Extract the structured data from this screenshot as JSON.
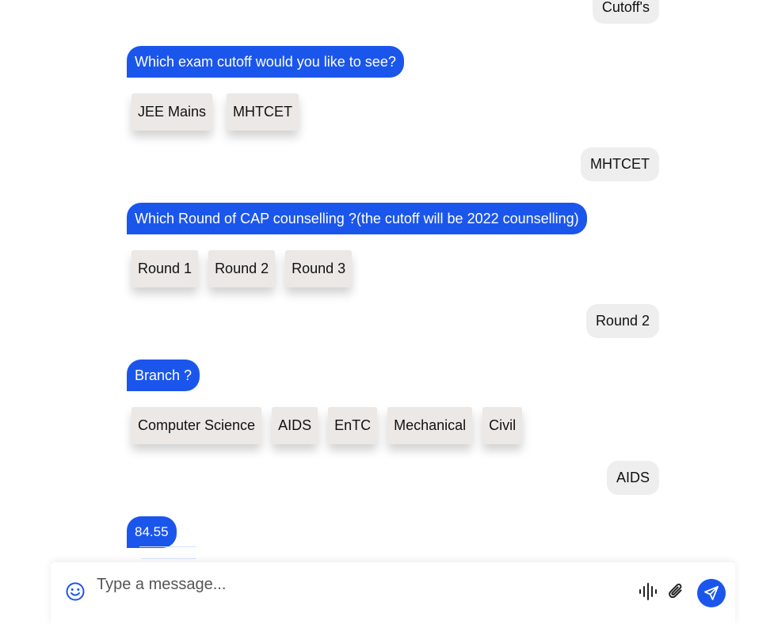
{
  "conversation": [
    {
      "from": "user",
      "text": "Cutoff's"
    },
    {
      "from": "bot",
      "text": "Which exam cutoff would you like to see?",
      "options": [
        "JEE Mains",
        "MHTCET"
      ]
    },
    {
      "from": "user",
      "text": "MHTCET"
    },
    {
      "from": "bot",
      "text": "Which Round of CAP counselling ?(the cutoff will be 2022 counselling)",
      "options": [
        "Round 1",
        "Round 2",
        "Round 3"
      ]
    },
    {
      "from": "user",
      "text": "Round 2"
    },
    {
      "from": "bot",
      "text": "Branch ?",
      "options": [
        "Computer Science",
        "AIDS",
        "EnTC",
        "Mechanical",
        "Civil"
      ]
    },
    {
      "from": "user",
      "text": "AIDS"
    },
    {
      "from": "bot",
      "text": "84.55"
    }
  ],
  "composer": {
    "placeholder": "Type a message...",
    "value": "",
    "icons": {
      "emoji": "smiley-icon",
      "voice": "voice-wave-icon",
      "attach": "paperclip-icon",
      "send": "paper-plane-icon"
    }
  },
  "colors": {
    "bot_bubble": "#1b56ec",
    "user_bubble": "#efeeee",
    "chip": "#ebe8e6",
    "accent": "#1b56ec"
  }
}
